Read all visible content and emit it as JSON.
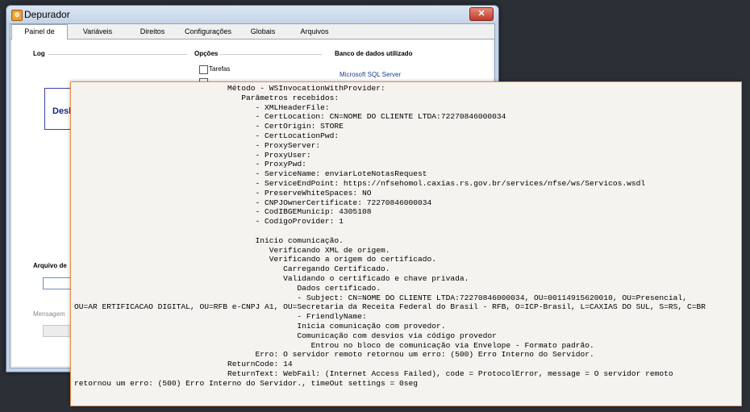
{
  "window": {
    "title": "Depurador",
    "close_label": "✕"
  },
  "tabs": [
    {
      "label": "Painel de Controle"
    },
    {
      "label": "Variáveis"
    },
    {
      "label": "Direitos"
    },
    {
      "label": "Configurações"
    },
    {
      "label": "Globais"
    },
    {
      "label": "Arquivos"
    }
  ],
  "panel": {
    "log_label": "Log",
    "log_text": "Desl",
    "options_label": "Opções",
    "options": [
      {
        "label": "Tarefas"
      }
    ],
    "database_label": "Banco de dados utilizado",
    "database_value": "Microsoft SQL Server",
    "file_label": "Arquivo de",
    "message_label": "Mensagem"
  },
  "output": {
    "lines": [
      "                                 Método - WSInvocationWithProvider:",
      "                                    Parâmetros recebidos:",
      "                                       - XMLHeaderFile:",
      "                                       - CertLocation: CN=NOME DO CLIENTE LTDA:72270846000034",
      "                                       - CertOrigin: STORE",
      "                                       - CertLocationPwd:",
      "                                       - ProxyServer:",
      "                                       - ProxyUser:",
      "                                       - ProxyPwd:",
      "                                       - ServiceName: enviarLoteNotasRequest",
      "                                       - ServiceEndPoint: https://nfsehomol.caxias.rs.gov.br/services/nfse/ws/Servicos.wsdl",
      "                                       - PreserveWhiteSpaces: NO",
      "                                       - CNPJOwnerCertificate: 72270846000034",
      "                                       - CodIBGEMunicip: 4305108",
      "                                       - CodigoProvider: 1",
      "",
      "                                       Inicio comunicação.",
      "                                          Verificando XML de origem.",
      "                                          Verificando a origem do certificado.",
      "                                             Carregando Certificado.",
      "                                             Validando o certificado e chave privada.",
      "                                                Dados certificado.",
      "                                                - Subject: CN=NOME DO CLIENTE LTDA:72270846000034, OU=00114915620010, OU=Presencial,",
      "OU=AR ERTIFICACAO DIGITAL, OU=RFB e-CNPJ A1, OU=Secretaria da Receita Federal do Brasil - RFB, O=ICP-Brasil, L=CAXIAS DO SUL, S=RS, C=BR",
      "                                                - FriendlyName:",
      "                                                Inicia comunicação com provedor.",
      "                                                Comunicação com desvios via código provedor",
      "                                                   Entrou no bloco de comunicação via Envelope - Formato padrão.",
      "                                       Erro: O servidor remoto retornou um erro: (500) Erro Interno do Servidor.",
      "                                 ReturnCode: 14",
      "                                 ReturnText: WebFail: (Internet Access Failed), code = ProtocolError, message = O servidor remoto",
      "retornou um erro: (500) Erro Interno do Servidor., timeOut settings = 0seg"
    ]
  },
  "colors": {
    "output_border": "#e8914a",
    "desktop": "#2b2f36"
  }
}
